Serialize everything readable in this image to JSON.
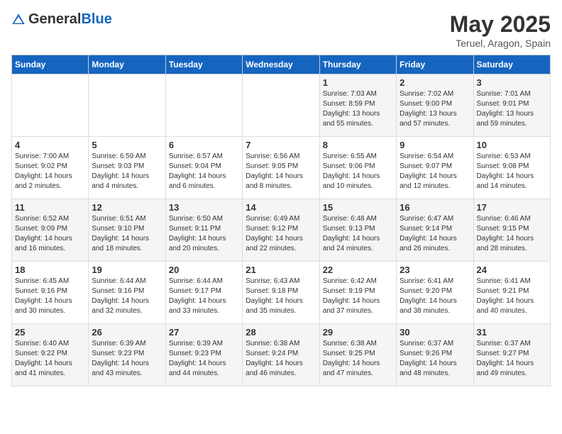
{
  "logo": {
    "general": "General",
    "blue": "Blue"
  },
  "title": "May 2025",
  "location": "Teruel, Aragon, Spain",
  "days_of_week": [
    "Sunday",
    "Monday",
    "Tuesday",
    "Wednesday",
    "Thursday",
    "Friday",
    "Saturday"
  ],
  "weeks": [
    [
      {
        "day": "",
        "info": ""
      },
      {
        "day": "",
        "info": ""
      },
      {
        "day": "",
        "info": ""
      },
      {
        "day": "",
        "info": ""
      },
      {
        "day": "1",
        "info": "Sunrise: 7:03 AM\nSunset: 8:59 PM\nDaylight: 13 hours\nand 55 minutes."
      },
      {
        "day": "2",
        "info": "Sunrise: 7:02 AM\nSunset: 9:00 PM\nDaylight: 13 hours\nand 57 minutes."
      },
      {
        "day": "3",
        "info": "Sunrise: 7:01 AM\nSunset: 9:01 PM\nDaylight: 13 hours\nand 59 minutes."
      }
    ],
    [
      {
        "day": "4",
        "info": "Sunrise: 7:00 AM\nSunset: 9:02 PM\nDaylight: 14 hours\nand 2 minutes."
      },
      {
        "day": "5",
        "info": "Sunrise: 6:59 AM\nSunset: 9:03 PM\nDaylight: 14 hours\nand 4 minutes."
      },
      {
        "day": "6",
        "info": "Sunrise: 6:57 AM\nSunset: 9:04 PM\nDaylight: 14 hours\nand 6 minutes."
      },
      {
        "day": "7",
        "info": "Sunrise: 6:56 AM\nSunset: 9:05 PM\nDaylight: 14 hours\nand 8 minutes."
      },
      {
        "day": "8",
        "info": "Sunrise: 6:55 AM\nSunset: 9:06 PM\nDaylight: 14 hours\nand 10 minutes."
      },
      {
        "day": "9",
        "info": "Sunrise: 6:54 AM\nSunset: 9:07 PM\nDaylight: 14 hours\nand 12 minutes."
      },
      {
        "day": "10",
        "info": "Sunrise: 6:53 AM\nSunset: 9:08 PM\nDaylight: 14 hours\nand 14 minutes."
      }
    ],
    [
      {
        "day": "11",
        "info": "Sunrise: 6:52 AM\nSunset: 9:09 PM\nDaylight: 14 hours\nand 16 minutes."
      },
      {
        "day": "12",
        "info": "Sunrise: 6:51 AM\nSunset: 9:10 PM\nDaylight: 14 hours\nand 18 minutes."
      },
      {
        "day": "13",
        "info": "Sunrise: 6:50 AM\nSunset: 9:11 PM\nDaylight: 14 hours\nand 20 minutes."
      },
      {
        "day": "14",
        "info": "Sunrise: 6:49 AM\nSunset: 9:12 PM\nDaylight: 14 hours\nand 22 minutes."
      },
      {
        "day": "15",
        "info": "Sunrise: 6:48 AM\nSunset: 9:13 PM\nDaylight: 14 hours\nand 24 minutes."
      },
      {
        "day": "16",
        "info": "Sunrise: 6:47 AM\nSunset: 9:14 PM\nDaylight: 14 hours\nand 26 minutes."
      },
      {
        "day": "17",
        "info": "Sunrise: 6:46 AM\nSunset: 9:15 PM\nDaylight: 14 hours\nand 28 minutes."
      }
    ],
    [
      {
        "day": "18",
        "info": "Sunrise: 6:45 AM\nSunset: 9:16 PM\nDaylight: 14 hours\nand 30 minutes."
      },
      {
        "day": "19",
        "info": "Sunrise: 6:44 AM\nSunset: 9:16 PM\nDaylight: 14 hours\nand 32 minutes."
      },
      {
        "day": "20",
        "info": "Sunrise: 6:44 AM\nSunset: 9:17 PM\nDaylight: 14 hours\nand 33 minutes."
      },
      {
        "day": "21",
        "info": "Sunrise: 6:43 AM\nSunset: 9:18 PM\nDaylight: 14 hours\nand 35 minutes."
      },
      {
        "day": "22",
        "info": "Sunrise: 6:42 AM\nSunset: 9:19 PM\nDaylight: 14 hours\nand 37 minutes."
      },
      {
        "day": "23",
        "info": "Sunrise: 6:41 AM\nSunset: 9:20 PM\nDaylight: 14 hours\nand 38 minutes."
      },
      {
        "day": "24",
        "info": "Sunrise: 6:41 AM\nSunset: 9:21 PM\nDaylight: 14 hours\nand 40 minutes."
      }
    ],
    [
      {
        "day": "25",
        "info": "Sunrise: 6:40 AM\nSunset: 9:22 PM\nDaylight: 14 hours\nand 41 minutes."
      },
      {
        "day": "26",
        "info": "Sunrise: 6:39 AM\nSunset: 9:23 PM\nDaylight: 14 hours\nand 43 minutes."
      },
      {
        "day": "27",
        "info": "Sunrise: 6:39 AM\nSunset: 9:23 PM\nDaylight: 14 hours\nand 44 minutes."
      },
      {
        "day": "28",
        "info": "Sunrise: 6:38 AM\nSunset: 9:24 PM\nDaylight: 14 hours\nand 46 minutes."
      },
      {
        "day": "29",
        "info": "Sunrise: 6:38 AM\nSunset: 9:25 PM\nDaylight: 14 hours\nand 47 minutes."
      },
      {
        "day": "30",
        "info": "Sunrise: 6:37 AM\nSunset: 9:26 PM\nDaylight: 14 hours\nand 48 minutes."
      },
      {
        "day": "31",
        "info": "Sunrise: 6:37 AM\nSunset: 9:27 PM\nDaylight: 14 hours\nand 49 minutes."
      }
    ]
  ]
}
